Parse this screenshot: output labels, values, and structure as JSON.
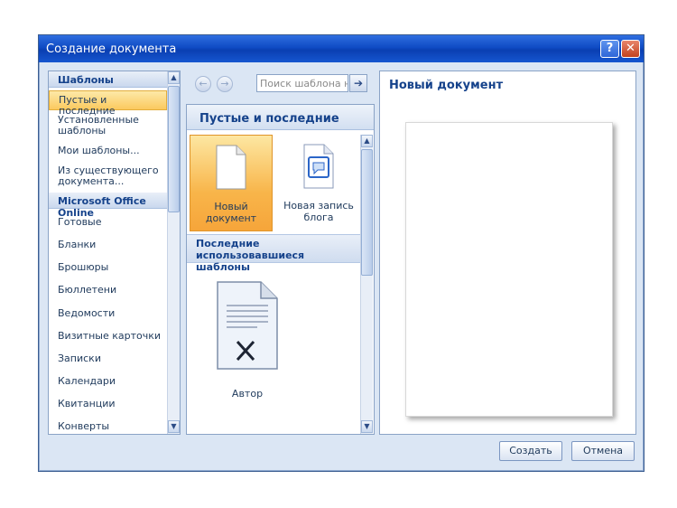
{
  "window": {
    "title": "Создание документа"
  },
  "titlebar": {
    "help_label": "?",
    "close_label": "✕"
  },
  "left_panel": {
    "section_templates": "Шаблоны",
    "items": [
      "Пустые и последние",
      "Установленные шаблоны",
      "Мои шаблоны...",
      "Из существующего документа..."
    ],
    "section_online": "Microsoft Office Online",
    "online_items": [
      "Готовые",
      "Бланки",
      "Брошюры",
      "Бюллетени",
      "Ведомости",
      "Визитные карточки",
      "Записки",
      "Календари",
      "Квитанции",
      "Конверты"
    ]
  },
  "search": {
    "placeholder": "Поиск шаблона на",
    "go_label": "➔"
  },
  "middle_panel": {
    "heading": "Пустые и последние",
    "tiles": [
      {
        "label": "Новый документ",
        "icon": "blank-document-icon"
      },
      {
        "label": "Новая запись блога",
        "icon": "blog-post-icon"
      }
    ],
    "recent_heading": "Последние использовавшиеся шаблоны",
    "recent_items": [
      {
        "label": "Автор",
        "icon": "template-document-icon"
      }
    ]
  },
  "preview": {
    "title": "Новый документ"
  },
  "buttons": {
    "create": "Создать",
    "cancel": "Отмена"
  },
  "colors": {
    "titlebar": "#0f4bc4",
    "selection": "#fbc95e",
    "panel_bg": "#dbe6f4"
  }
}
